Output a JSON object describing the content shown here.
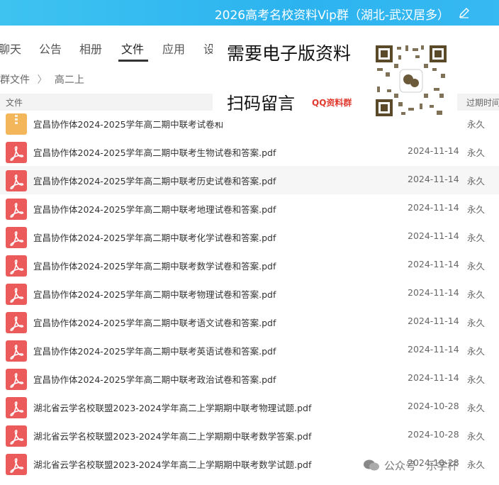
{
  "window": {
    "title": "2026高考名校资料Vip群（湖北-武汉居多）",
    "edit_icon": "pencil-icon"
  },
  "tabs": [
    {
      "label": "聊天"
    },
    {
      "label": "公告"
    },
    {
      "label": "相册"
    },
    {
      "label": "文件",
      "active": true
    },
    {
      "label": "应用"
    },
    {
      "label": "设"
    }
  ],
  "breadcrumb": {
    "root": "群文件",
    "separator": "〉",
    "current": "高二上"
  },
  "table": {
    "col_file": "文件",
    "col_expire": "过期时间"
  },
  "files": [
    {
      "name": "宜昌协作体2024-2025学年高二期中联考试卷和",
      "date": "",
      "expire": "永久",
      "type": "zip"
    },
    {
      "name": "宜昌协作体2024-2025学年高二期中联考生物试卷和答案.pdf",
      "date": "2024-11-14",
      "expire": "永久",
      "type": "pdf"
    },
    {
      "name": "宜昌协作体2024-2025学年高二期中联考历史试卷和答案.pdf",
      "date": "2024-11-14",
      "expire": "永久",
      "type": "pdf"
    },
    {
      "name": "宜昌协作体2024-2025学年高二期中联考地理试卷和答案.pdf",
      "date": "2024-11-14",
      "expire": "永久",
      "type": "pdf"
    },
    {
      "name": "宜昌协作体2024-2025学年高二期中联考化学试卷和答案.pdf",
      "date": "2024-11-14",
      "expire": "永久",
      "type": "pdf"
    },
    {
      "name": "宜昌协作体2024-2025学年高二期中联考数学试卷和答案.pdf",
      "date": "2024-11-14",
      "expire": "永久",
      "type": "pdf"
    },
    {
      "name": "宜昌协作体2024-2025学年高二期中联考物理试卷和答案.pdf",
      "date": "2024-11-14",
      "expire": "永久",
      "type": "pdf"
    },
    {
      "name": "宜昌协作体2024-2025学年高二期中联考语文试卷和答案.pdf",
      "date": "2024-11-14",
      "expire": "永久",
      "type": "pdf"
    },
    {
      "name": "宜昌协作体2024-2025学年高二期中联考英语试卷和答案.pdf",
      "date": "2024-11-14",
      "expire": "永久",
      "type": "pdf"
    },
    {
      "name": "宜昌协作体2024-2025学年高二期中联考政治试卷和答案.pdf",
      "date": "2024-11-14",
      "expire": "永久",
      "type": "pdf"
    },
    {
      "name": "湖北省云学名校联盟2023-2024学年高二上学期期中联考物理试题.pdf",
      "date": "2024-10-28",
      "expire": "永久",
      "type": "pdf"
    },
    {
      "name": "湖北省云学名校联盟2023-2024学年高二上学期期中联考数学答案.pdf",
      "date": "2024-10-28",
      "expire": "永久",
      "type": "pdf"
    },
    {
      "name": "湖北省云学名校联盟2023-2024学年高二上学期期中联考数学试题.pdf",
      "date": "2024-10-28",
      "expire": "永久",
      "type": "pdf"
    }
  ],
  "ad": {
    "line1": "需要电子版资料",
    "line2": "扫码留言",
    "tag": "QQ资料群"
  },
  "watermark": {
    "text": "公众号 · 乐学杯",
    "icon": "wechat-icon"
  }
}
